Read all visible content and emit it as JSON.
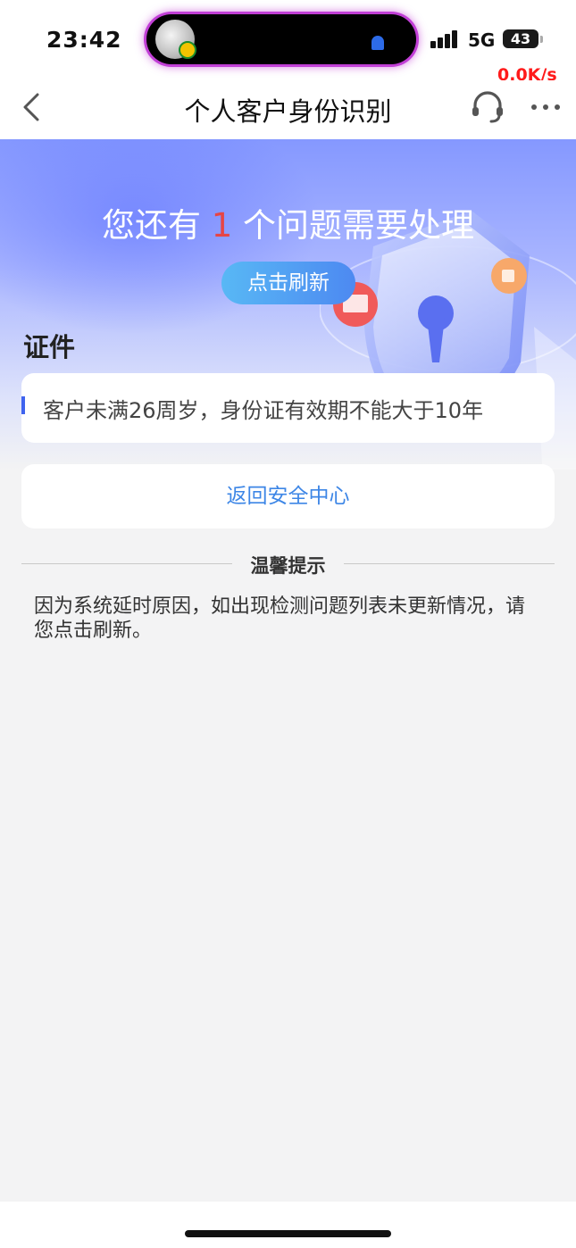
{
  "status_bar": {
    "time": "23:42",
    "network": "5G",
    "battery": "43",
    "net_speed": "0.0K/s"
  },
  "nav": {
    "title": "个人客户身份识别",
    "back_icon": "chevron-left-icon",
    "support_icon": "headset-icon",
    "more_icon": "more-dots-icon"
  },
  "hero": {
    "heading_prefix": "您还有",
    "issue_count": "1",
    "heading_suffix": "个问题需要处理",
    "refresh_label": "点击刷新"
  },
  "section": {
    "label": "证件"
  },
  "issues": [
    {
      "text": "客户未满26周岁，身份证有效期不能大于10年"
    }
  ],
  "return_button": {
    "label": "返回安全中心"
  },
  "tips": {
    "title": "温馨提示",
    "text": "因为系统延时原因，如出现检测问题列表未更新情况，请您点击刷新。"
  },
  "colors": {
    "accent_red": "#e64545",
    "link_blue": "#3d86e6",
    "hero_blue": "#8598ff",
    "speed_red": "#ff1a1a"
  }
}
